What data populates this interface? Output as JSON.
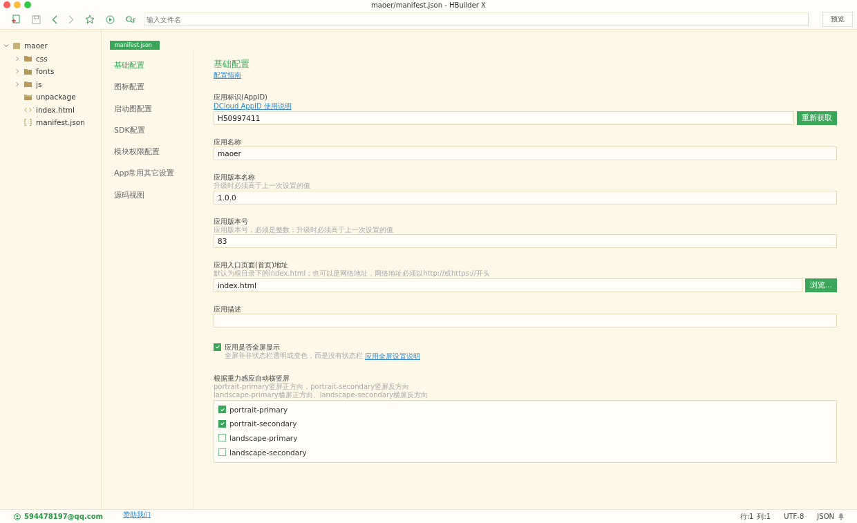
{
  "window": {
    "title": "maoer/manifest.json - HBuilder X"
  },
  "toolbar": {
    "search_placeholder": "输入文件名",
    "preview_button": "预览"
  },
  "file_tree": {
    "name": "maoer",
    "expanded": true,
    "children": [
      {
        "name": "css",
        "kind": "folder",
        "expanded": false
      },
      {
        "name": "fonts",
        "kind": "folder",
        "expanded": false
      },
      {
        "name": "js",
        "kind": "folder",
        "expanded": false
      },
      {
        "name": "unpackage",
        "kind": "empty-folder"
      },
      {
        "name": "index.html",
        "kind": "html"
      },
      {
        "name": "manifest.json",
        "kind": "json"
      }
    ]
  },
  "editor_tab": {
    "label": "manifest.json",
    "selected": true
  },
  "nav": [
    {
      "label": "基础配置",
      "selected": true
    },
    {
      "label": "图标配置",
      "selected": false
    },
    {
      "label": "启动图配置",
      "selected": false
    },
    {
      "label": "SDK配置",
      "selected": false
    },
    {
      "label": "模块权限配置",
      "selected": false
    },
    {
      "label": "App常用其它设置",
      "selected": false
    },
    {
      "label": "源码视图",
      "selected": false
    }
  ],
  "form": {
    "title": "基础配置",
    "guide_link": "配置指南",
    "fields": [
      {
        "kind": "text",
        "label": "应用标识(AppID)",
        "link": "DCloud AppID 使用说明",
        "value": "H50997411",
        "button": "重新获取"
      },
      {
        "kind": "text",
        "label": "应用名称",
        "value": "maoer"
      },
      {
        "kind": "text",
        "label": "应用版本名称",
        "hint": "升级时必须高于上一次设置的值",
        "value": "1.0.0"
      },
      {
        "kind": "text",
        "label": "应用版本号",
        "hint": "应用版本号，必须是整数；升级时必须高于上一次设置的值",
        "value": "83"
      },
      {
        "kind": "text",
        "label": "应用入口页面(首页)地址",
        "hint": "默认为根目录下的index.html；也可以是网络地址，网络地址必须以http://或https://开头",
        "value": "index.html",
        "button": "浏览..."
      },
      {
        "kind": "text",
        "label": "应用描述"
      },
      {
        "kind": "checkbox",
        "label": "应用是否全屏显示",
        "checked": true,
        "hint": "全屏并非状态栏透明或变色，而是没有状态栏",
        "link": "应用全屏设置说明"
      },
      {
        "kind": "checkgroup",
        "label": "根据重力感应自动横竖屏",
        "hint_lines": [
          "portrait-primary竖屏正方向，portrait-secondary竖屏反方向",
          "landscape-primary横屏正方向、landscape-secondary横屏反方向"
        ],
        "options": [
          {
            "label": "portrait-primary",
            "checked": true
          },
          {
            "label": "portrait-secondary",
            "checked": true
          },
          {
            "label": "landscape-primary",
            "checked": false
          },
          {
            "label": "landscape-secondary",
            "checked": false
          }
        ]
      }
    ]
  },
  "status_bar": {
    "account": "594478197@qq.com",
    "sponsor_link": "赞助我们",
    "line": "行:1",
    "column": "列:1",
    "encoding": "UTF-8",
    "language": "JSON"
  }
}
